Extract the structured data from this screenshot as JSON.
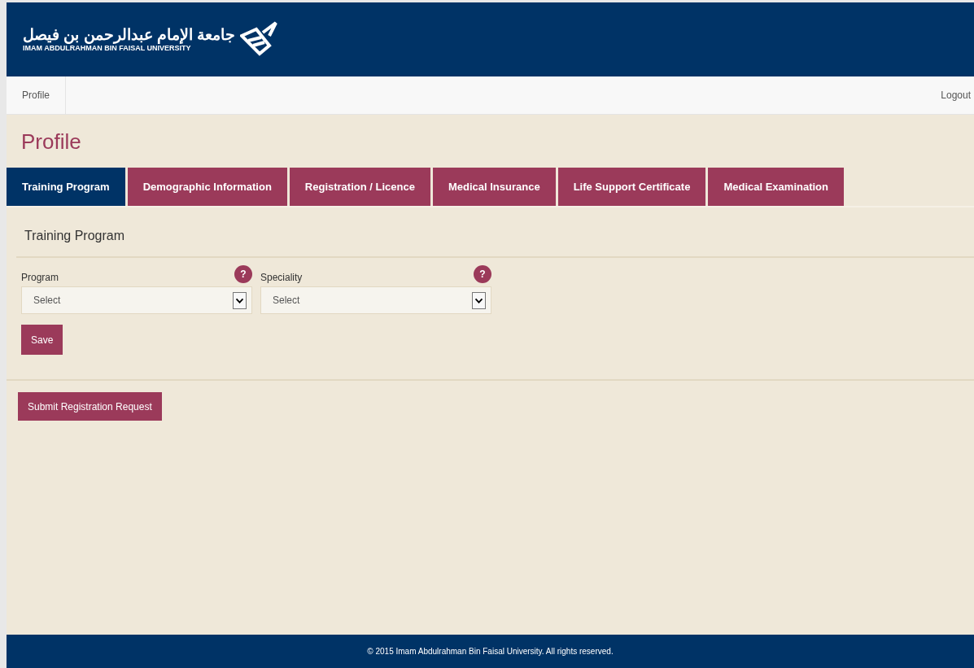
{
  "header": {
    "logo_arabic": "جامعة الإمام عبدالرحمن بن فيصل",
    "logo_english": "IMAM ABDULRAHMAN BIN FAISAL UNIVERSITY"
  },
  "nav": {
    "items": [
      {
        "label": "Profile",
        "selected": true
      }
    ],
    "logout": "Logout"
  },
  "page_title": "Profile",
  "tabs": [
    {
      "label": "Training Program",
      "selected": true
    },
    {
      "label": "Demographic Information",
      "selected": false
    },
    {
      "label": "Registration / Licence",
      "selected": false
    },
    {
      "label": "Medical Insurance",
      "selected": false
    },
    {
      "label": "Life Support Certificate",
      "selected": false
    },
    {
      "label": "Medical Examination",
      "selected": false
    }
  ],
  "section_title": "Training Program",
  "fields": [
    {
      "label": "Program",
      "help": "?",
      "value": "Select"
    },
    {
      "label": "Speciality",
      "help": "?",
      "value": "Select"
    }
  ],
  "save_button": "Save",
  "submit_button": "Submit Registration Request",
  "footer": "© 2015 Imam Abdulrahman Bin Faisal University. All rights reserved."
}
